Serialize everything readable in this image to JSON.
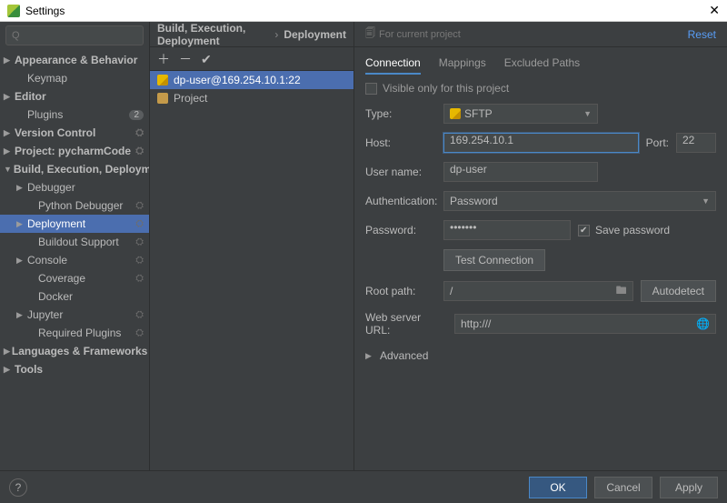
{
  "window": {
    "title": "Settings"
  },
  "search": {
    "placeholder": "Q"
  },
  "sidebar": {
    "items": [
      {
        "label": "Appearance & Behavior",
        "expand": "r",
        "level": 1
      },
      {
        "label": "Keymap",
        "level": 2,
        "noarrow": true
      },
      {
        "label": "Editor",
        "expand": "r",
        "level": 1
      },
      {
        "label": "Plugins",
        "level": 2,
        "noarrow": true,
        "badge": "2"
      },
      {
        "label": "Version Control",
        "expand": "r",
        "level": 1,
        "gear": true
      },
      {
        "label": "Project: pycharmCode",
        "expand": "r",
        "level": 1,
        "gear": true
      },
      {
        "label": "Build, Execution, Deployment",
        "expand": "d",
        "level": 1
      },
      {
        "label": "Debugger",
        "expand": "r",
        "level": 2
      },
      {
        "label": "Python Debugger",
        "level": 3,
        "noarrow": true,
        "gear": true
      },
      {
        "label": "Deployment",
        "expand": "r",
        "level": 2,
        "gear": true,
        "selected": true
      },
      {
        "label": "Buildout Support",
        "level": 3,
        "noarrow": true,
        "gear": true
      },
      {
        "label": "Console",
        "expand": "r",
        "level": 2,
        "gear": true
      },
      {
        "label": "Coverage",
        "level": 3,
        "noarrow": true,
        "gear": true
      },
      {
        "label": "Docker",
        "level": 3,
        "noarrow": true
      },
      {
        "label": "Jupyter",
        "expand": "r",
        "level": 2,
        "gear": true
      },
      {
        "label": "Required Plugins",
        "level": 3,
        "noarrow": true,
        "gear": true
      },
      {
        "label": "Languages & Frameworks",
        "expand": "r",
        "level": 1
      },
      {
        "label": "Tools",
        "expand": "r",
        "level": 1
      }
    ]
  },
  "breadcrumb": {
    "a": "Build, Execution, Deployment",
    "b": "Deployment"
  },
  "top": {
    "hint": "For current project",
    "reset": "Reset"
  },
  "tabs": {
    "connection": "Connection",
    "mappings": "Mappings",
    "excluded": "Excluded Paths"
  },
  "list": {
    "items": [
      {
        "label": "dp-user@169.254.10.1:22",
        "icon": "server",
        "selected": true
      },
      {
        "label": "Project",
        "icon": "folder"
      }
    ]
  },
  "form": {
    "visible_only": "Visible only for this project",
    "type_label": "Type:",
    "type_value": "SFTP",
    "host_label": "Host:",
    "host_value": "169.254.10.1",
    "port_label": "Port:",
    "port_value": "22",
    "user_label": "User name:",
    "user_value": "dp-user",
    "auth_label": "Authentication:",
    "auth_value": "Password",
    "pass_label": "Password:",
    "pass_value": "•••••••",
    "save_pass": "Save password",
    "test_conn": "Test Connection",
    "root_label": "Root path:",
    "root_value": "/",
    "autodetect": "Autodetect",
    "web_label": "Web server URL:",
    "web_value": "http:///",
    "advanced": "Advanced"
  },
  "footer": {
    "help": "?",
    "ok": "OK",
    "cancel": "Cancel",
    "apply": "Apply"
  }
}
